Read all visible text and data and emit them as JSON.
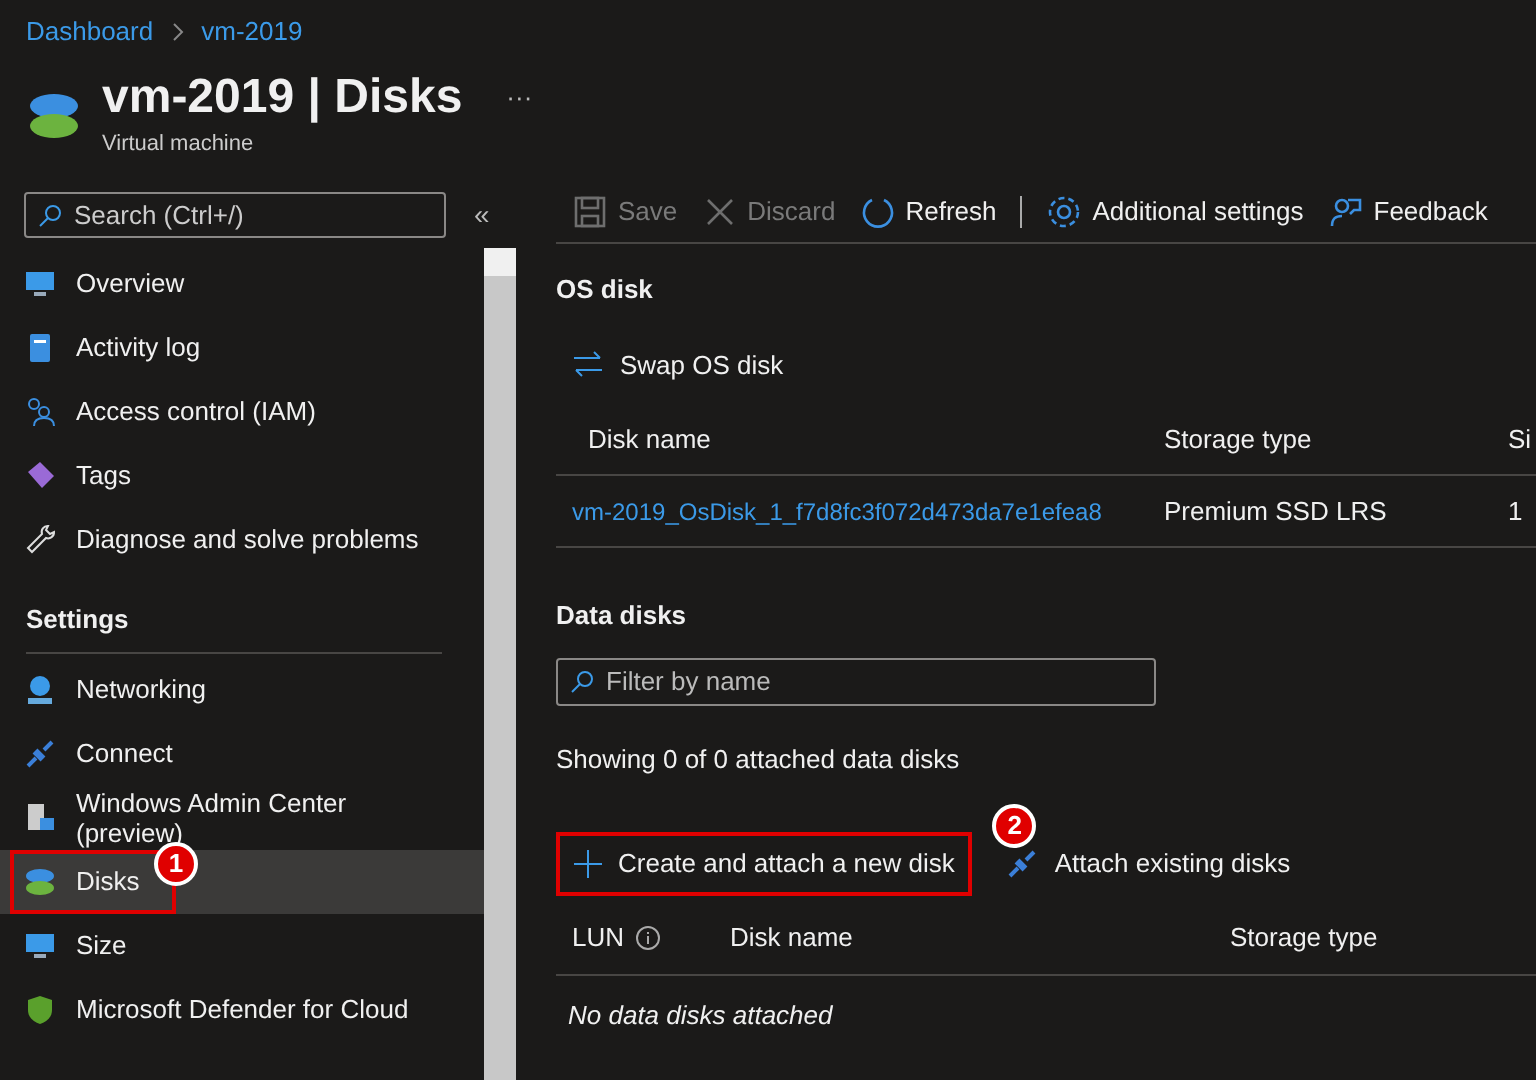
{
  "breadcrumb": [
    {
      "label": "Dashboard"
    },
    {
      "label": "vm-2019"
    }
  ],
  "header": {
    "title": "vm-2019 | Disks",
    "subtitle": "Virtual machine",
    "more": "···"
  },
  "sidebar": {
    "search": {
      "placeholder": "Search (Ctrl+/)"
    },
    "collapse": "«",
    "items": [
      {
        "kind": "item",
        "label": "Overview",
        "selected": false
      },
      {
        "kind": "item",
        "label": "Activity log",
        "selected": false
      },
      {
        "kind": "item",
        "label": "Access control (IAM)",
        "selected": false
      },
      {
        "kind": "item",
        "label": "Tags",
        "selected": false
      },
      {
        "kind": "item",
        "label": "Diagnose and solve problems",
        "selected": false
      },
      {
        "kind": "section",
        "label": "Settings"
      },
      {
        "kind": "item",
        "label": "Networking",
        "selected": false
      },
      {
        "kind": "item",
        "label": "Connect",
        "selected": false
      },
      {
        "kind": "item",
        "label": "Windows Admin Center (preview)",
        "selected": false
      },
      {
        "kind": "item",
        "label": "Disks",
        "selected": true,
        "callout": "1"
      },
      {
        "kind": "item",
        "label": "Size",
        "selected": false
      },
      {
        "kind": "item",
        "label": "Microsoft Defender for Cloud",
        "selected": false
      }
    ]
  },
  "toolbar": [
    {
      "label": "Save",
      "disabled": true
    },
    {
      "label": "Discard",
      "disabled": true
    },
    {
      "label": "Refresh",
      "disabled": false
    },
    {
      "label": "Additional settings",
      "disabled": false
    },
    {
      "label": "Feedback",
      "disabled": false
    }
  ],
  "os_disk": {
    "title": "OS disk",
    "swap": "Swap OS disk",
    "columns": [
      "Disk name",
      "Storage type",
      "Si"
    ],
    "rows": [
      [
        "vm-2019_OsDisk_1_f7d8fc3f072d473da7e1efea8",
        "Premium SSD LRS",
        "1"
      ]
    ]
  },
  "data_disks": {
    "title": "Data disks",
    "filter": {
      "placeholder": "Filter by name"
    },
    "summary": "Showing 0 of 0 attached data disks",
    "actions": [
      {
        "label": "Create and attach a new disk",
        "callout": "2"
      },
      {
        "label": "Attach existing disks"
      }
    ],
    "columns": [
      "LUN",
      "Disk name",
      "Storage type"
    ],
    "empty": "No data disks attached"
  }
}
